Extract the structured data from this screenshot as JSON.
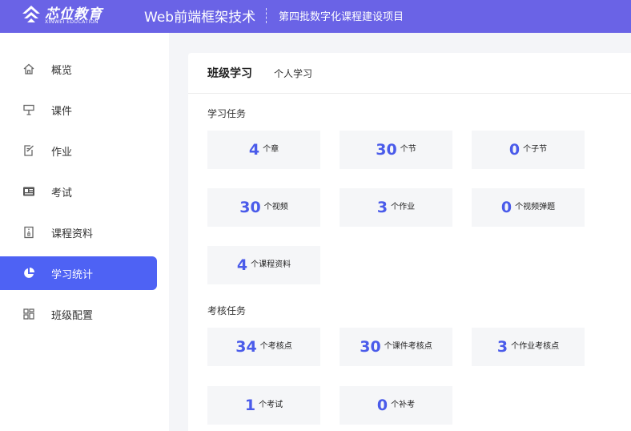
{
  "header": {
    "logo_text": "芯位教育",
    "logo_sub": "XINWEI EDUCATION",
    "course_title": "Web前端框架技术",
    "project_title": "第四批数字化课程建设项目"
  },
  "sidebar": {
    "items": [
      {
        "label": "概览"
      },
      {
        "label": "课件"
      },
      {
        "label": "作业"
      },
      {
        "label": "考试"
      },
      {
        "label": "课程资料"
      },
      {
        "label": "学习统计"
      },
      {
        "label": "班级配置"
      }
    ],
    "active_index": 5
  },
  "tabs": {
    "main": "班级学习",
    "sub": "个人学习"
  },
  "learning_tasks": {
    "title": "学习任务",
    "cards": [
      {
        "num": "4",
        "unit": "个章"
      },
      {
        "num": "30",
        "unit": "个节"
      },
      {
        "num": "0",
        "unit": "个子节"
      },
      {
        "num": "30",
        "unit": "个视频"
      },
      {
        "num": "3",
        "unit": "个作业"
      },
      {
        "num": "0",
        "unit": "个视频弹题"
      },
      {
        "num": "4",
        "unit": "个课程资料"
      }
    ]
  },
  "assessment_tasks": {
    "title": "考核任务",
    "cards": [
      {
        "num": "34",
        "unit": "个考核点"
      },
      {
        "num": "30",
        "unit": "个课件考核点"
      },
      {
        "num": "3",
        "unit": "个作业考核点"
      },
      {
        "num": "1",
        "unit": "个考试"
      },
      {
        "num": "0",
        "unit": "个补考"
      }
    ]
  },
  "colors": {
    "header_bg": "#6a63e6",
    "accent": "#4e62f4",
    "number": "#4a5bea"
  }
}
